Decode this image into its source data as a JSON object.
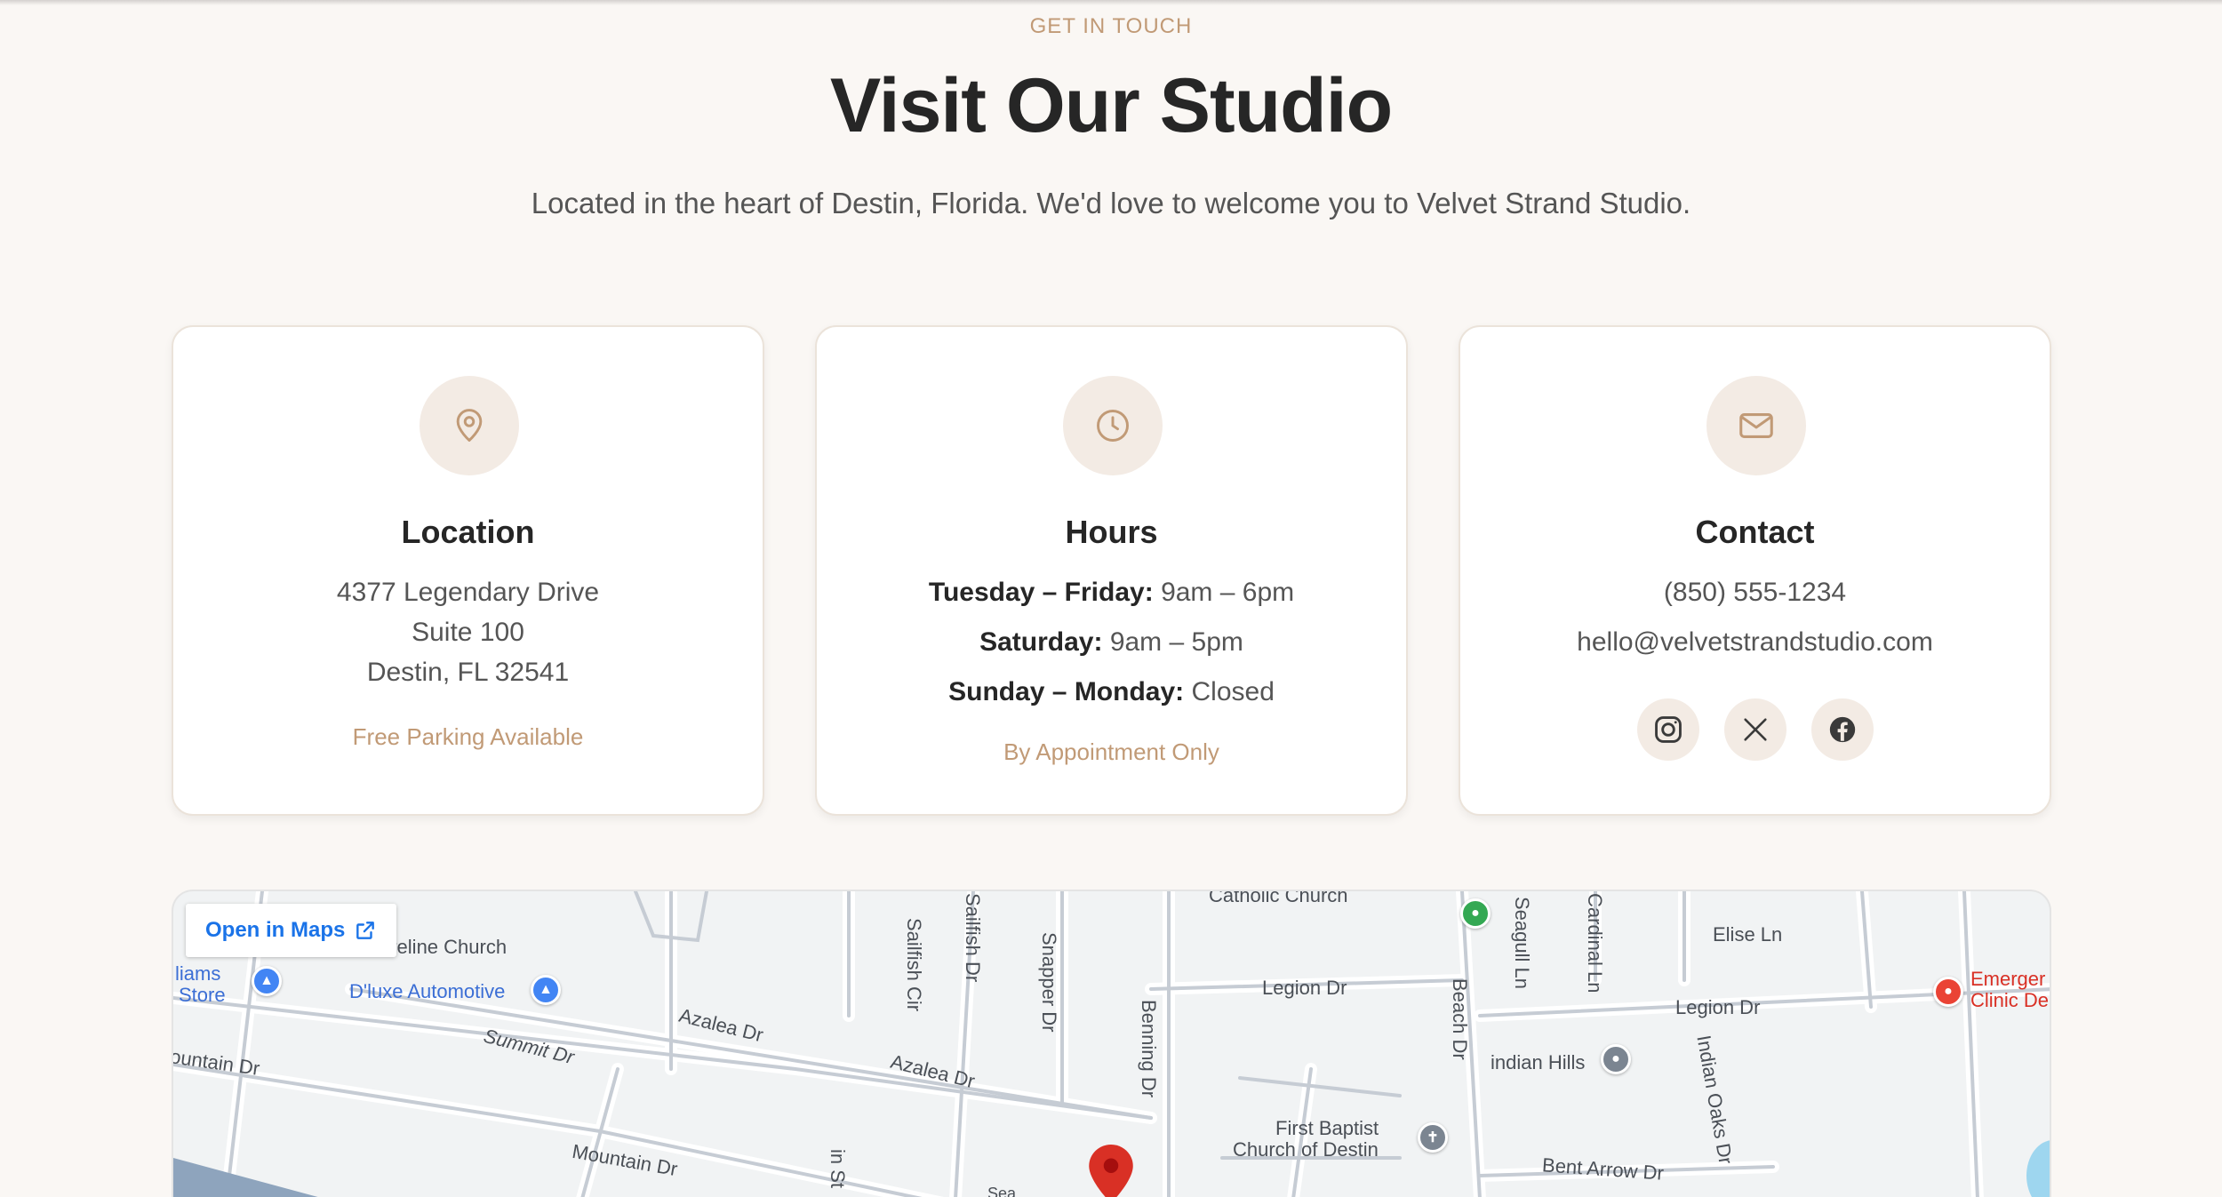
{
  "colors": {
    "accent": "#c19a76",
    "background": "#faf7f4",
    "icon_bg": "#f3ebe4",
    "map_link": "#1a73e8"
  },
  "header": {
    "eyebrow": "GET IN TOUCH",
    "title": "Visit Our Studio",
    "subtitle": "Located in the heart of Destin, Florida. We'd love to welcome you to Velvet Strand Studio."
  },
  "location": {
    "icon": "map-pin-icon",
    "title": "Location",
    "line1": "4377 Legendary Drive",
    "line2": "Suite 100",
    "line3": "Destin, FL 32541",
    "note": "Free Parking Available"
  },
  "hours": {
    "icon": "clock-icon",
    "title": "Hours",
    "rows": [
      {
        "days": "Tuesday – Friday:",
        "time": "9am – 6pm"
      },
      {
        "days": "Saturday:",
        "time": "9am – 5pm"
      },
      {
        "days": "Sunday – Monday:",
        "time": "Closed"
      }
    ],
    "note": "By Appointment Only"
  },
  "contact": {
    "icon": "mail-icon",
    "title": "Contact",
    "phone": "(850) 555-1234",
    "email": "hello@velvetstrandstudio.com",
    "socials": [
      "instagram-icon",
      "x-icon",
      "facebook-icon"
    ]
  },
  "map": {
    "open_label": "Open in Maps",
    "labels": {
      "catholic": "Catholic Church",
      "shoreline": "oreline Church",
      "williams1": "liams",
      "williams2": "Store",
      "dluxe": "D'luxe Automotive",
      "azalea1": "Azalea Dr",
      "azalea2": "Azalea Dr",
      "summit": "Summit Dr",
      "mountain1": "ountain Dr",
      "mountain2": "Mountain Dr",
      "sailfish_cir": "Sailfish Cir",
      "sailfish_dr": "Sailfish Dr",
      "snapper": "Snapper Dr",
      "benning": "Benning Dr",
      "legion1": "Legion Dr",
      "legion2": "Legion Dr",
      "beach": "Beach Dr",
      "seagull": "Seagull Ln",
      "cardinal": "Cardinal Ln",
      "elise": "Elise Ln",
      "indian_hills": "indian Hills",
      "indian_oaks": "Indian Oaks Dr",
      "first_baptist1": "First Baptist",
      "first_baptist2": "Church of Destin",
      "bent_arrow": "Bent Arrow Dr",
      "emergency1": "Emerger",
      "emergency2": "Clinic De",
      "sea": "Sea",
      "in_st": "in St"
    }
  }
}
